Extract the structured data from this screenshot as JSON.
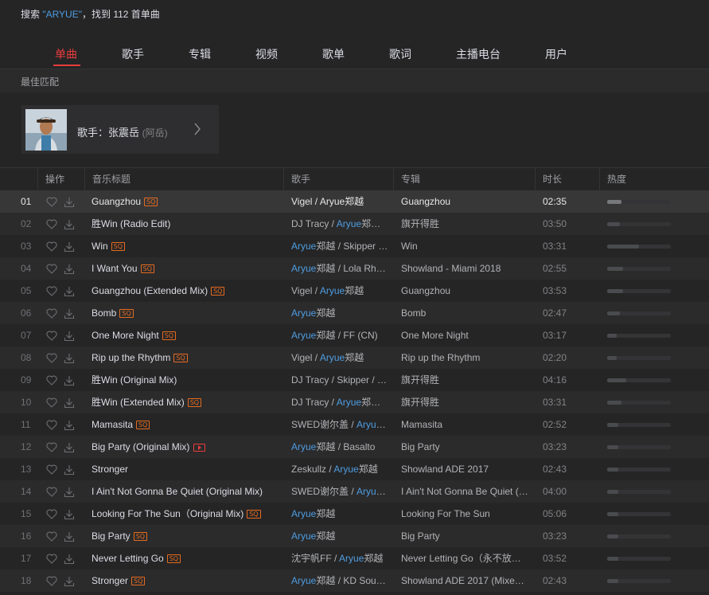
{
  "search": {
    "prefix": "搜索 ",
    "keyword": "\"ARYUE\"",
    "suffix": "，找到 112 首单曲"
  },
  "tabs": [
    "单曲",
    "歌手",
    "专辑",
    "视频",
    "歌单",
    "歌词",
    "主播电台",
    "用户"
  ],
  "active_tab": "单曲",
  "best_match": {
    "header": "最佳匹配",
    "artist_label": "歌手：张震岳",
    "artist_alias": "(阿岳)"
  },
  "table": {
    "columns": [
      "操作",
      "音乐标题",
      "歌手",
      "专辑",
      "时长",
      "热度"
    ],
    "rows": [
      {
        "num": "01",
        "title": "Guangzhou",
        "badge": "SQ",
        "artist": [
          {
            "t": "Vigel / "
          },
          {
            "t": "Aryue郑越"
          }
        ],
        "album": "Guangzhou",
        "duration": "02:35",
        "heat": 0.22
      },
      {
        "num": "02",
        "title": "胜Win (Radio Edit)",
        "badge": "",
        "artist": [
          {
            "t": "DJ Tracy / "
          },
          {
            "t": "Aryue",
            "hl": true
          },
          {
            "t": "郑越…"
          }
        ],
        "album": "旗开得胜",
        "duration": "03:50",
        "heat": 0.2
      },
      {
        "num": "03",
        "title": "Win",
        "badge": "SQ",
        "artist": [
          {
            "t": "Aryue",
            "hl": true
          },
          {
            "t": "郑越 / Skipper …"
          }
        ],
        "album": "Win",
        "duration": "03:31",
        "heat": 0.5
      },
      {
        "num": "04",
        "title": "I Want You",
        "badge": "SQ",
        "artist": [
          {
            "t": "Aryue",
            "hl": true
          },
          {
            "t": "郑越 / Lola Rh…"
          }
        ],
        "album": "Showland - Miami 2018",
        "duration": "02:55",
        "heat": 0.25
      },
      {
        "num": "05",
        "title": "Guangzhou (Extended Mix)",
        "badge": "SQ",
        "artist": [
          {
            "t": "Vigel / "
          },
          {
            "t": "Aryue",
            "hl": true
          },
          {
            "t": "郑越"
          }
        ],
        "album": "Guangzhou",
        "duration": "03:53",
        "heat": 0.25
      },
      {
        "num": "06",
        "title": "Bomb",
        "badge": "SQ",
        "artist": [
          {
            "t": "Aryue",
            "hl": true
          },
          {
            "t": "郑越"
          }
        ],
        "album": "Bomb",
        "duration": "02:47",
        "heat": 0.2
      },
      {
        "num": "07",
        "title": "One More Night",
        "badge": "SQ",
        "artist": [
          {
            "t": "Aryue",
            "hl": true
          },
          {
            "t": "郑越 / FF (CN)"
          }
        ],
        "album": "One More Night",
        "duration": "03:17",
        "heat": 0.15
      },
      {
        "num": "08",
        "title": "Rip up the Rhythm",
        "badge": "SQ",
        "artist": [
          {
            "t": "Vigel / "
          },
          {
            "t": "Aryue",
            "hl": true
          },
          {
            "t": "郑越"
          }
        ],
        "album": "Rip up the Rhythm",
        "duration": "02:20",
        "heat": 0.15
      },
      {
        "num": "09",
        "title": "胜Win (Original Mix)",
        "badge": "",
        "artist": [
          {
            "t": "DJ Tracy / Skipper / …"
          }
        ],
        "album": "旗开得胜",
        "duration": "04:16",
        "heat": 0.3
      },
      {
        "num": "10",
        "title": "胜Win (Extended Mix)",
        "badge": "SQ",
        "artist": [
          {
            "t": "DJ Tracy / "
          },
          {
            "t": "Aryue",
            "hl": true
          },
          {
            "t": "郑越…"
          }
        ],
        "album": "旗开得胜",
        "duration": "03:31",
        "heat": 0.22
      },
      {
        "num": "11",
        "title": "Mamasita",
        "badge": "SQ",
        "artist": [
          {
            "t": "SWED谢尔盖 / "
          },
          {
            "t": "Aryue…",
            "hl": true
          }
        ],
        "album": "Mamasita",
        "duration": "02:52",
        "heat": 0.18
      },
      {
        "num": "12",
        "title": "Big Party (Original Mix)",
        "badge": "MV",
        "artist": [
          {
            "t": "Aryue",
            "hl": true
          },
          {
            "t": "郑越 / Basalto"
          }
        ],
        "album": "Big Party",
        "duration": "03:23",
        "heat": 0.18
      },
      {
        "num": "13",
        "title": "Stronger",
        "badge": "",
        "artist": [
          {
            "t": "Zeskullz / "
          },
          {
            "t": "Aryue",
            "hl": true
          },
          {
            "t": "郑越"
          }
        ],
        "album": "Showland ADE 2017",
        "duration": "02:43",
        "heat": 0.18
      },
      {
        "num": "14",
        "title": "I Ain't Not Gonna Be Quiet (Original Mix)",
        "badge": "",
        "artist": [
          {
            "t": "SWED谢尔盖 / "
          },
          {
            "t": "Aryue…",
            "hl": true
          }
        ],
        "album": "I Ain't Not Gonna Be Quiet (…",
        "duration": "04:00",
        "heat": 0.18
      },
      {
        "num": "15",
        "title": "Looking For The Sun（Original Mix)",
        "badge": "SQ",
        "artist": [
          {
            "t": "Aryue",
            "hl": true
          },
          {
            "t": "郑越"
          }
        ],
        "album": "Looking For The Sun",
        "duration": "05:06",
        "heat": 0.18
      },
      {
        "num": "16",
        "title": "Big Party",
        "badge": "SQ",
        "artist": [
          {
            "t": "Aryue",
            "hl": true
          },
          {
            "t": "郑越"
          }
        ],
        "album": "Big Party",
        "duration": "03:23",
        "heat": 0.18
      },
      {
        "num": "17",
        "title": "Never Letting Go",
        "badge": "SQ",
        "artist": [
          {
            "t": "沈宇帆FF / "
          },
          {
            "t": "Aryue",
            "hl": true
          },
          {
            "t": "郑越"
          }
        ],
        "album": "Never Letting Go（永不放弃）",
        "duration": "03:52",
        "heat": 0.18
      },
      {
        "num": "18",
        "title": "Stronger",
        "badge": "SQ",
        "artist": [
          {
            "t": "Aryue",
            "hl": true
          },
          {
            "t": "郑越 / KD Sou…"
          }
        ],
        "album": "Showland ADE 2017 (Mixe…",
        "duration": "02:43",
        "heat": 0.18
      }
    ]
  },
  "colors": {
    "accent": "#e83c3c",
    "highlight": "#4f9de0",
    "badge": "#e46b1f"
  }
}
